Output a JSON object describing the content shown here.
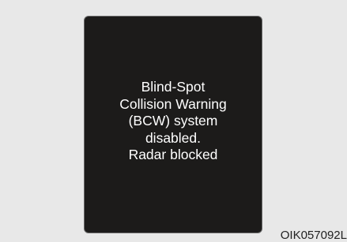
{
  "display": {
    "message_lines": [
      "Blind-Spot",
      "Collision Warning",
      "(BCW) system",
      "disabled.",
      "Radar blocked"
    ]
  },
  "figure_code": "OIK057092L",
  "colors": {
    "page_background": "#e8e8e8",
    "panel_background": "#1c1b1a",
    "message_text": "#ffffff"
  }
}
